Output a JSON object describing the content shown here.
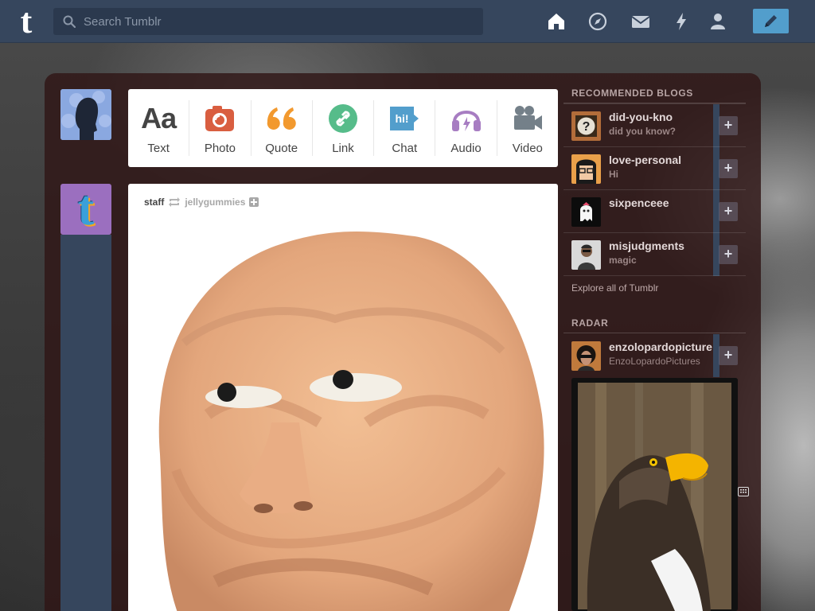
{
  "header": {
    "logo": "t",
    "search_placeholder": "Search Tumblr",
    "nav_icons": [
      "home-icon",
      "explore-icon",
      "inbox-icon",
      "activity-icon",
      "account-icon"
    ],
    "compose_icon": "pencil-icon",
    "bg_color": "#36465d",
    "accent_color": "#529ecc"
  },
  "post_types": [
    {
      "label": "Text",
      "icon": "text-icon",
      "color": "#444444"
    },
    {
      "label": "Photo",
      "icon": "photo-icon",
      "color": "#d95e40"
    },
    {
      "label": "Quote",
      "icon": "quote-icon",
      "color": "#f2992e"
    },
    {
      "label": "Link",
      "icon": "link-icon",
      "color": "#56bc8a"
    },
    {
      "label": "Chat",
      "icon": "chat-icon",
      "color": "#529ecc"
    },
    {
      "label": "Audio",
      "icon": "audio-icon",
      "color": "#a77dc2"
    },
    {
      "label": "Video",
      "icon": "video-icon",
      "color": "#748089"
    }
  ],
  "post": {
    "author": "staff",
    "reblogged_from": "jellygummies"
  },
  "sidebar": {
    "recommended_title": "RECOMMENDED BLOGS",
    "recommended": [
      {
        "name": "did-you-kno",
        "sub": "did you know?"
      },
      {
        "name": "love-personal",
        "sub": "Hi"
      },
      {
        "name": "sixpenceee",
        "sub": ""
      },
      {
        "name": "misjudgments",
        "sub": "magic"
      }
    ],
    "explore": "Explore all of Tumblr",
    "radar_title": "RADAR",
    "radar_blog": {
      "name": "enzolopardopicture",
      "sub": "EnzoLopardoPictures"
    }
  }
}
